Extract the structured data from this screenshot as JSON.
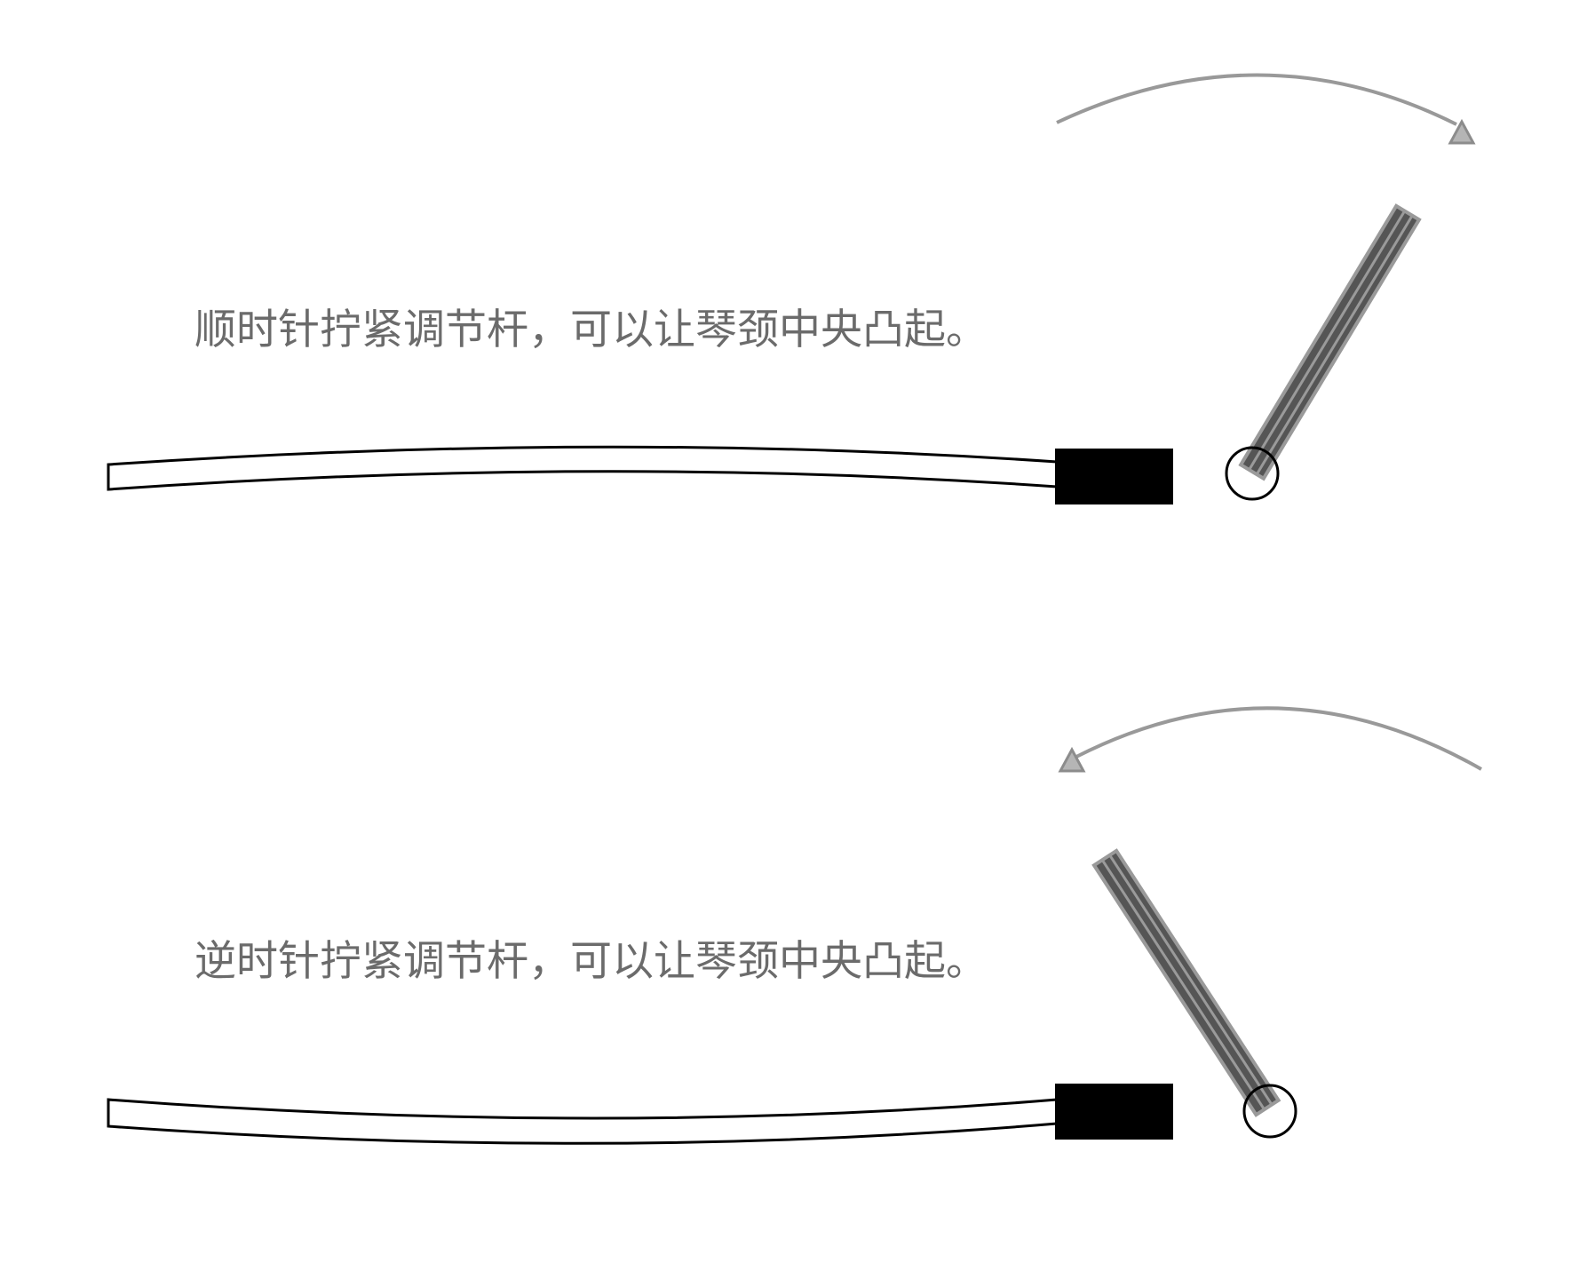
{
  "captions": {
    "clockwise": "顺时针拧紧调节杆，可以让琴颈中央凸起。",
    "counterclockwise": "逆时针拧紧调节杆，可以让琴颈中央凸起。"
  },
  "colors": {
    "caption": "#6b6b6b",
    "arrow": "#999999",
    "wrench_body": "#555555",
    "wrench_stripe": "#9a9a9a",
    "nut": "#000000",
    "neck_outline": "#000000"
  }
}
